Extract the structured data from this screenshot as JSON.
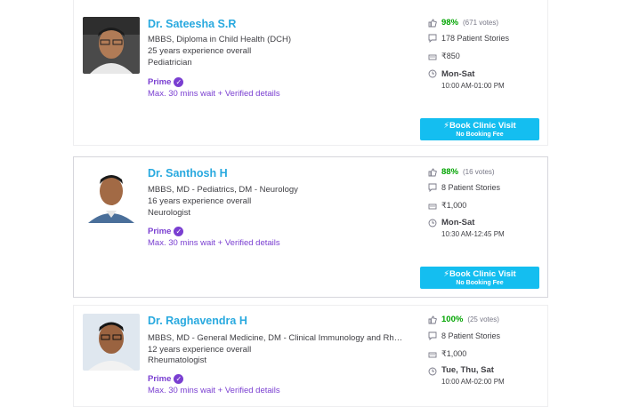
{
  "doctors": [
    {
      "name": "Dr. Sateesha S.R",
      "education": "MBBS, Diploma in Child Health (DCH)",
      "experience": "25 years experience overall",
      "specialty": "Pediatrician",
      "prime_label": "Prime",
      "wait_text": "Max. 30 mins wait + Verified details",
      "rating_pct": "98%",
      "votes": "(671 votes)",
      "stories": "178 Patient Stories",
      "fee": "₹850",
      "days": "Mon-Sat",
      "hours": "10:00 AM-01:00 PM",
      "book_label": "Book Clinic Visit",
      "book_sub": "No Booking Fee"
    },
    {
      "name": "Dr. Santhosh H",
      "education": "MBBS, MD - Pediatrics, DM - Neurology",
      "experience": "16 years experience overall",
      "specialty": "Neurologist",
      "prime_label": "Prime",
      "wait_text": "Max. 30 mins wait + Verified details",
      "rating_pct": "88%",
      "votes": "(16 votes)",
      "stories": "8 Patient Stories",
      "fee": "₹1,000",
      "days": "Mon-Sat",
      "hours": "10:30 AM-12:45 PM",
      "book_label": "Book Clinic Visit",
      "book_sub": "No Booking Fee"
    },
    {
      "name": "Dr. Raghavendra H",
      "education": "MBBS, MD - General Medicine, DM - Clinical Immunology and Rheuma...",
      "experience": "12 years experience overall",
      "specialty": "Rheumatologist",
      "prime_label": "Prime",
      "wait_text": "Max. 30 mins wait + Verified details",
      "rating_pct": "100%",
      "votes": "(25 votes)",
      "stories": "8 Patient Stories",
      "fee": "₹1,000",
      "days": "Tue, Thu, Sat",
      "hours": "10:00 AM-02:00 PM"
    }
  ],
  "colors": {
    "name": "#28a9df",
    "prime": "#7a3fd1",
    "rating": "#01a400",
    "book_button": "#14bef0"
  },
  "icons": [
    "thumbs-up-icon",
    "chat-icon",
    "money-icon",
    "clock-icon",
    "lightning-icon",
    "verified-check-icon"
  ]
}
